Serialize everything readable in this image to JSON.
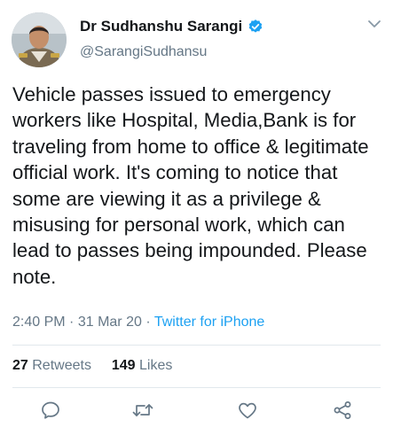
{
  "user": {
    "display_name": "Dr Sudhanshu Sarangi",
    "handle": "@SarangiSudhansu",
    "verified": true
  },
  "tweet": {
    "text": "Vehicle passes issued to emergency workers like Hospital, Media,Bank is for traveling from home to office & legitimate official work. It's coming to notice that some are viewing it as a privilege & misusing for personal work, which can lead to passes being impounded. Please note.",
    "time": "2:40 PM",
    "date": "31 Mar 20",
    "separator": "·",
    "source": "Twitter for iPhone"
  },
  "stats": {
    "retweets_count": "27",
    "retweets_label": "Retweets",
    "likes_count": "149",
    "likes_label": "Likes"
  },
  "icons": {
    "verified": "verified-badge-icon",
    "menu": "chevron-down-icon",
    "reply": "reply-icon",
    "retweet": "retweet-icon",
    "like": "heart-icon",
    "share": "share-icon"
  },
  "colors": {
    "accent": "#1da1f2",
    "text_primary": "#14171a",
    "text_secondary": "#657786",
    "divider": "#e1e8ed"
  }
}
